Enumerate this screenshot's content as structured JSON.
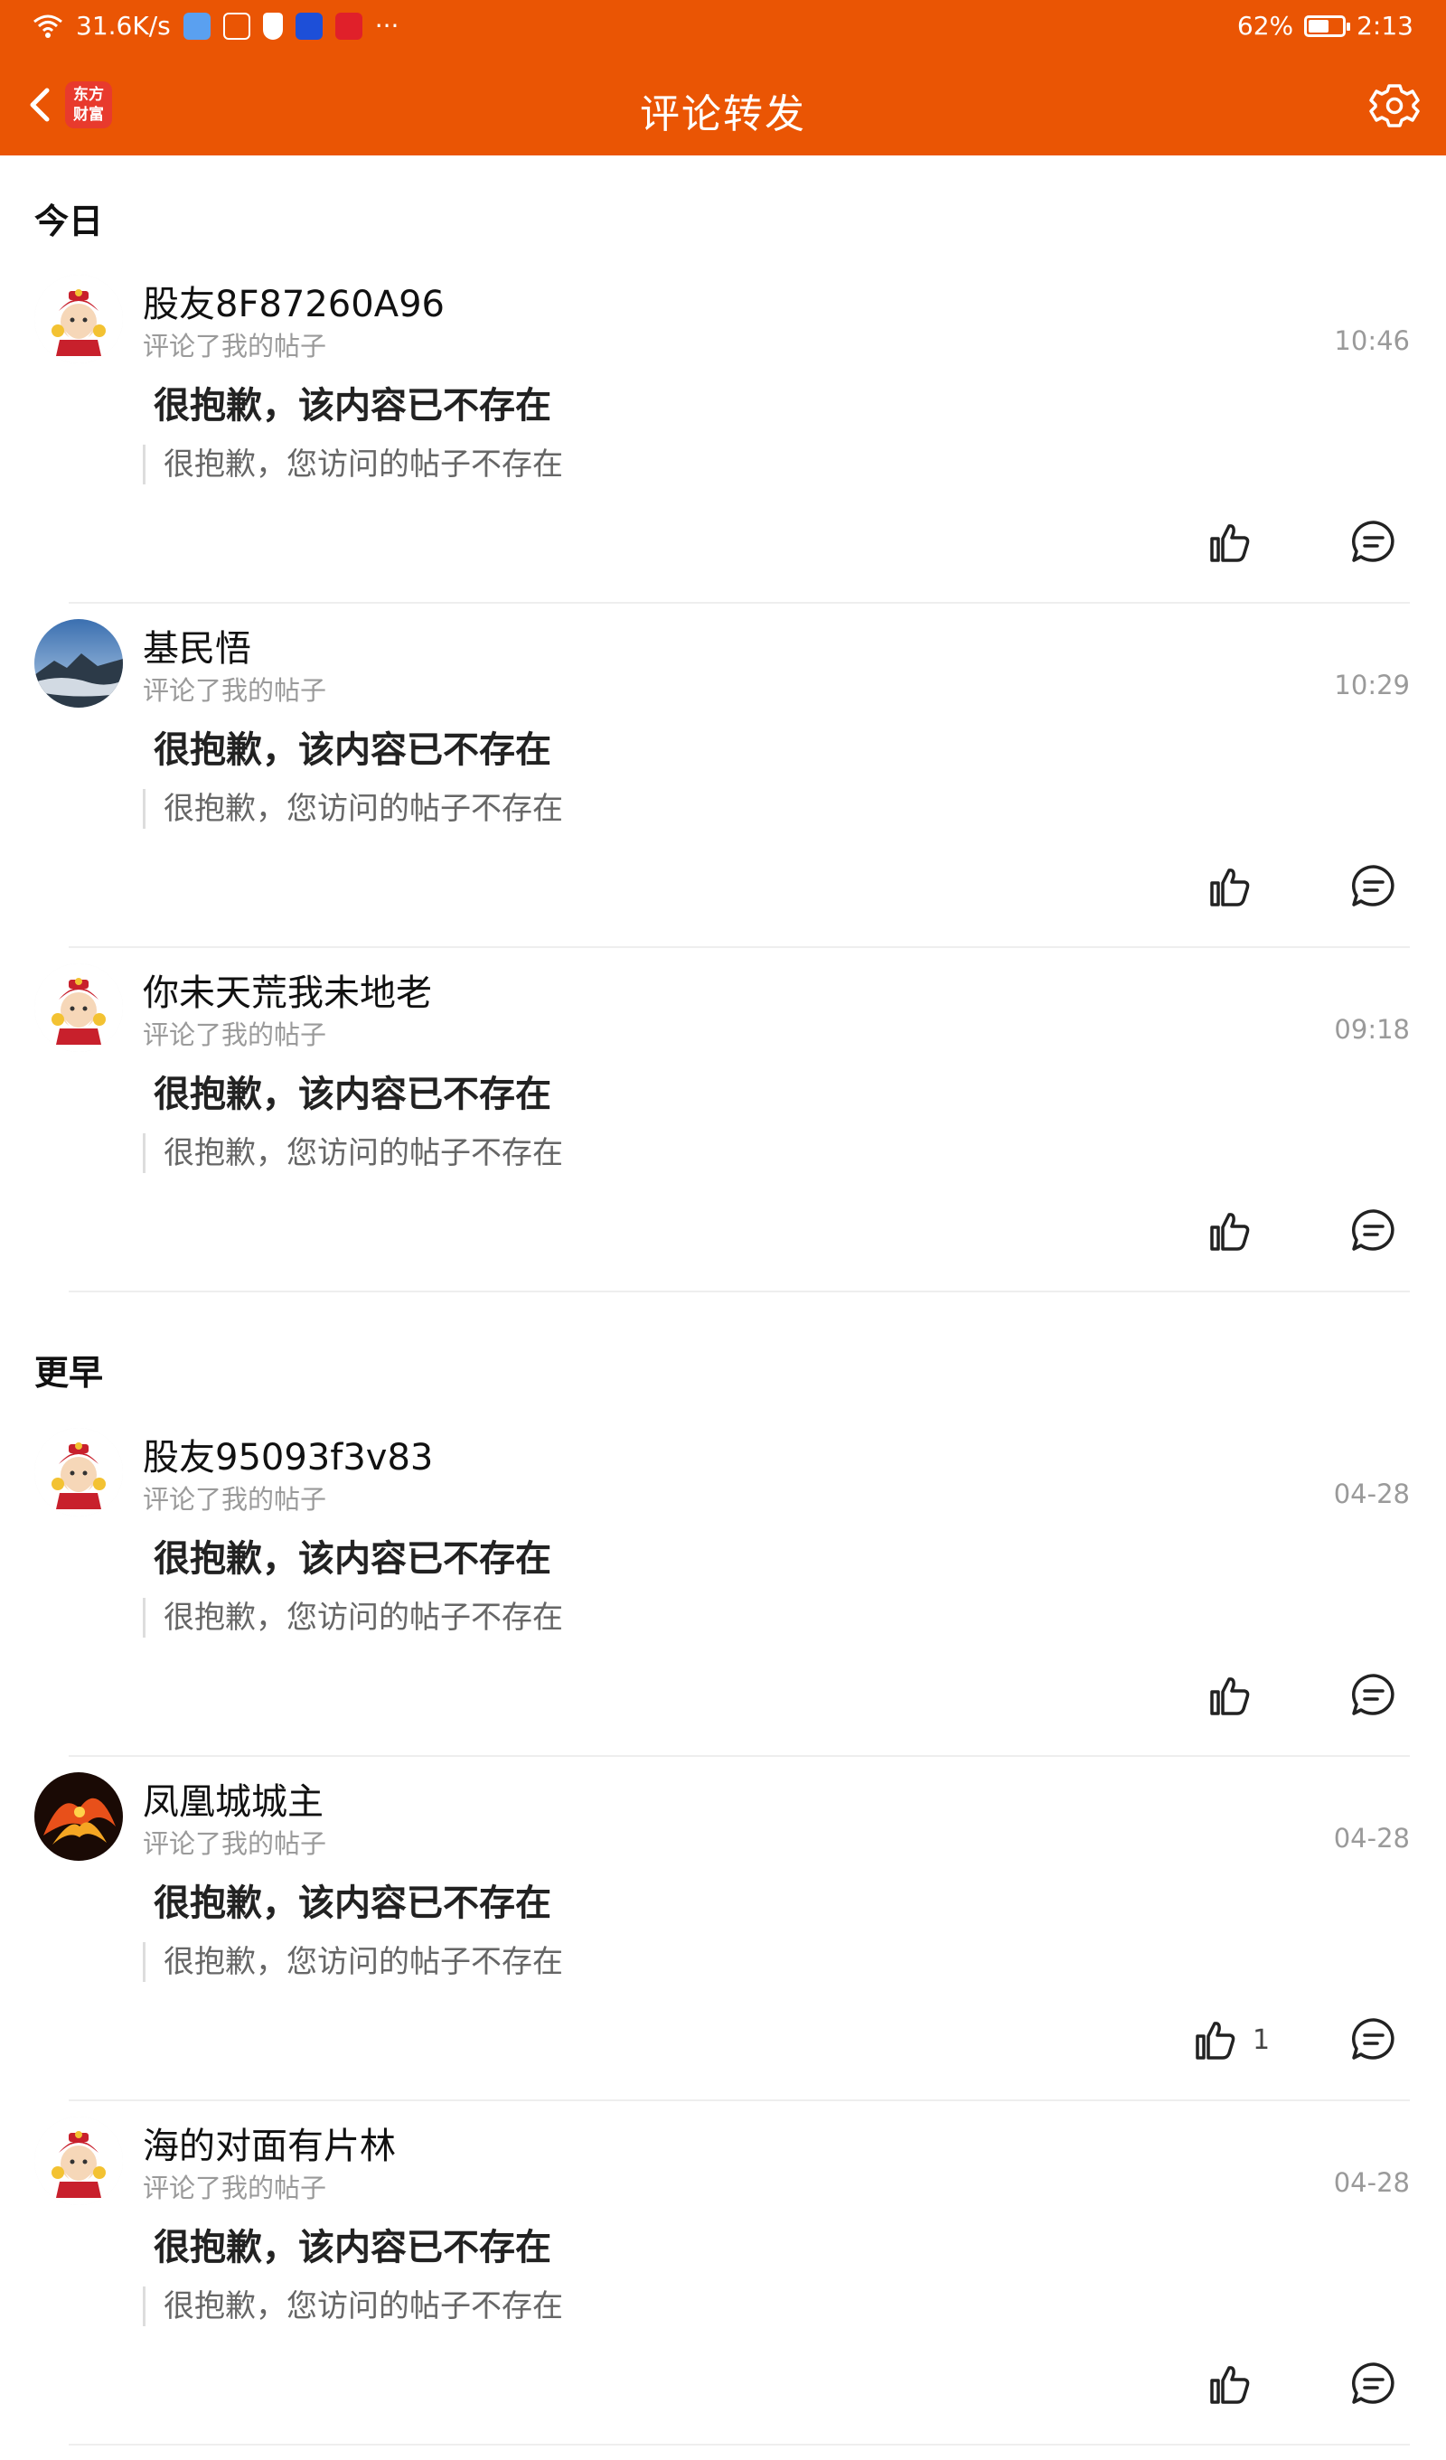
{
  "status_bar": {
    "speed": "31.6K/s",
    "battery": "62%",
    "battery_level": 0.62,
    "time": "2:13",
    "more": "···"
  },
  "app_bar": {
    "logo_text_1": "东方",
    "logo_text_2": "财富",
    "title": "评论转发"
  },
  "sections": {
    "today": "今日",
    "earlier": "更早"
  },
  "items": [
    {
      "user": "股友8F87260A96",
      "action": "评论了我的帖子",
      "time": "10:46",
      "text": "很抱歉，该内容已不存在",
      "quote": "很抱歉，您访问的帖子不存在",
      "likes": "",
      "avatar": "mascot"
    },
    {
      "user": "基民悟",
      "action": "评论了我的帖子",
      "time": "10:29",
      "text": "很抱歉，该内容已不存在",
      "quote": "很抱歉，您访问的帖子不存在",
      "likes": "",
      "avatar": "landscape"
    },
    {
      "user": "你未天荒我未地老",
      "action": "评论了我的帖子",
      "time": "09:18",
      "text": "很抱歉，该内容已不存在",
      "quote": "很抱歉，您访问的帖子不存在",
      "likes": "",
      "avatar": "mascot"
    },
    {
      "user": "股友95093f3v83",
      "action": "评论了我的帖子",
      "time": "04-28",
      "text": "很抱歉，该内容已不存在",
      "quote": "很抱歉，您访问的帖子不存在",
      "likes": "",
      "avatar": "mascot"
    },
    {
      "user": "凤凰城城主",
      "action": "评论了我的帖子",
      "time": "04-28",
      "text": "很抱歉，该内容已不存在",
      "quote": "很抱歉，您访问的帖子不存在",
      "likes": "1",
      "avatar": "phoenix"
    },
    {
      "user": "海的对面有片林",
      "action": "评论了我的帖子",
      "time": "04-28",
      "text": "很抱歉，该内容已不存在",
      "quote": "很抱歉，您访问的帖子不存在",
      "likes": "",
      "avatar": "mascot"
    }
  ],
  "colors": {
    "brand": "#ea5504",
    "muted": "#9a9a9a"
  }
}
